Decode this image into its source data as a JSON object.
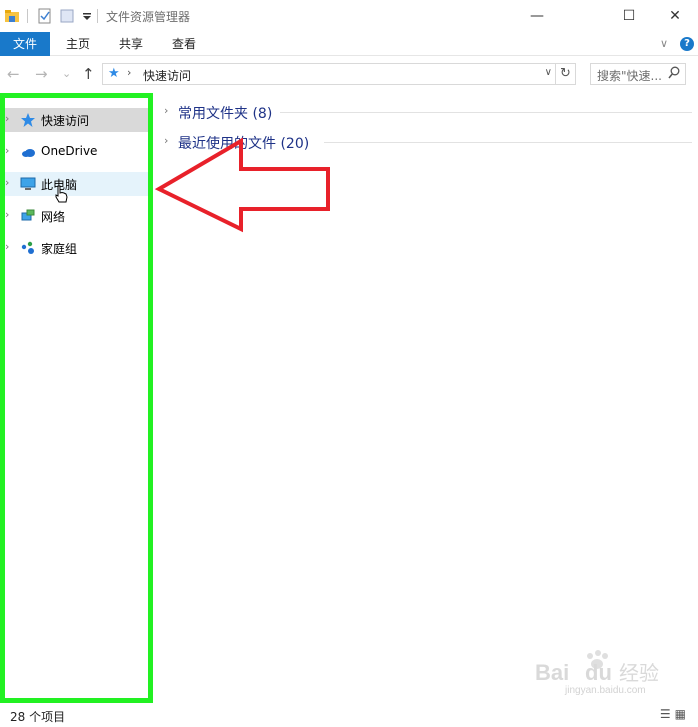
{
  "window": {
    "title": "文件资源管理器",
    "minimize_glyph": "—",
    "maximize_glyph": "☐",
    "close_glyph": "✕"
  },
  "ribbon": {
    "tabs": [
      {
        "label": "文件",
        "active": true
      },
      {
        "label": "主页"
      },
      {
        "label": "共享"
      },
      {
        "label": "查看"
      }
    ],
    "expand_glyph": "∨",
    "help_glyph": "?"
  },
  "address_bar": {
    "back_glyph": "←",
    "forward_glyph": "→",
    "recent_glyph": "⌄",
    "up_glyph": "↑",
    "path_separator": "›",
    "path": "快速访问",
    "dropdown_glyph": "∨",
    "refresh_glyph": "↻"
  },
  "search": {
    "placeholder": "搜索\"快速...",
    "icon": "search-icon"
  },
  "nav_pane": {
    "items": [
      {
        "label": "快速访问",
        "icon": "star-icon",
        "state": "selected"
      },
      {
        "label": "OneDrive",
        "icon": "cloud-icon",
        "state": "normal"
      },
      {
        "label": "此电脑",
        "icon": "computer-icon",
        "state": "hover"
      },
      {
        "label": "网络",
        "icon": "network-icon",
        "state": "normal"
      },
      {
        "label": "家庭组",
        "icon": "homegroup-icon",
        "state": "normal"
      }
    ]
  },
  "content": {
    "groups": [
      {
        "label": "常用文件夹 (8)"
      },
      {
        "label": "最近使用的文件 (20)"
      }
    ]
  },
  "status_bar": {
    "item_count": "28 个项目"
  },
  "annotations": {
    "highlight_color": "#22f122",
    "arrow_color": "#e8212a"
  },
  "watermark": {
    "brand": "Bai du 经验",
    "url": "jingyan.baidu.com"
  },
  "colors": {
    "accent": "#1979ca",
    "group_text": "#1e3287"
  }
}
